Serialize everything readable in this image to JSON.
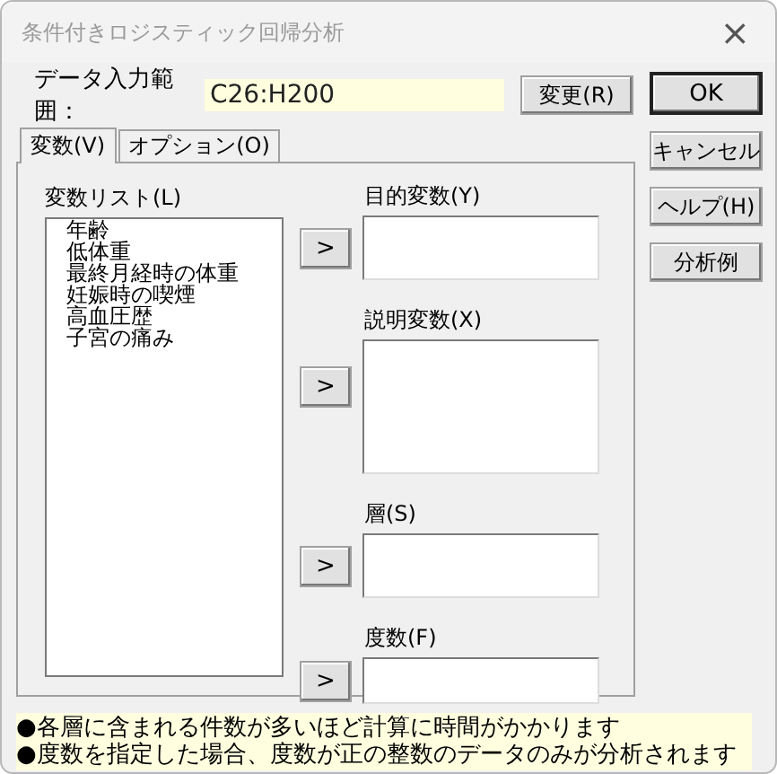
{
  "window": {
    "title": "条件付きロジスティック回帰分析",
    "close": "×"
  },
  "data_range": {
    "label": "データ入力範囲：",
    "value": "C26:H200",
    "button": "変更(R)"
  },
  "tabs": [
    {
      "label": "変数(V)",
      "selected": true
    },
    {
      "label": "オプション(O)",
      "selected": false
    }
  ],
  "variable_list": {
    "label": "変数リスト(L)",
    "items": [
      "年齢",
      "低体重",
      "最終月経時の体重",
      "妊娠時の喫煙",
      "高血圧歴",
      "子宮の痛み"
    ]
  },
  "targets": [
    {
      "label": "目的変数(Y)",
      "arrow": ">",
      "kind": "single"
    },
    {
      "label": "説明変数(X)",
      "arrow": ">",
      "kind": "multi"
    },
    {
      "label": "層(S)",
      "arrow": ">",
      "kind": "single"
    },
    {
      "label": "度数(F)",
      "arrow": ">",
      "kind": "short"
    }
  ],
  "buttons": [
    {
      "label": "OK",
      "kind": "default"
    },
    {
      "label": "キャンセル",
      "kind": "normal"
    },
    {
      "label": "ヘルプ(H)",
      "kind": "normal"
    },
    {
      "label": "分析例",
      "kind": "normal"
    }
  ],
  "notes": [
    "●各層に含まれる件数が多いほど計算に時間がかかります",
    "●度数を指定した場合、度数が正の整数のデータのみが分析されます"
  ]
}
